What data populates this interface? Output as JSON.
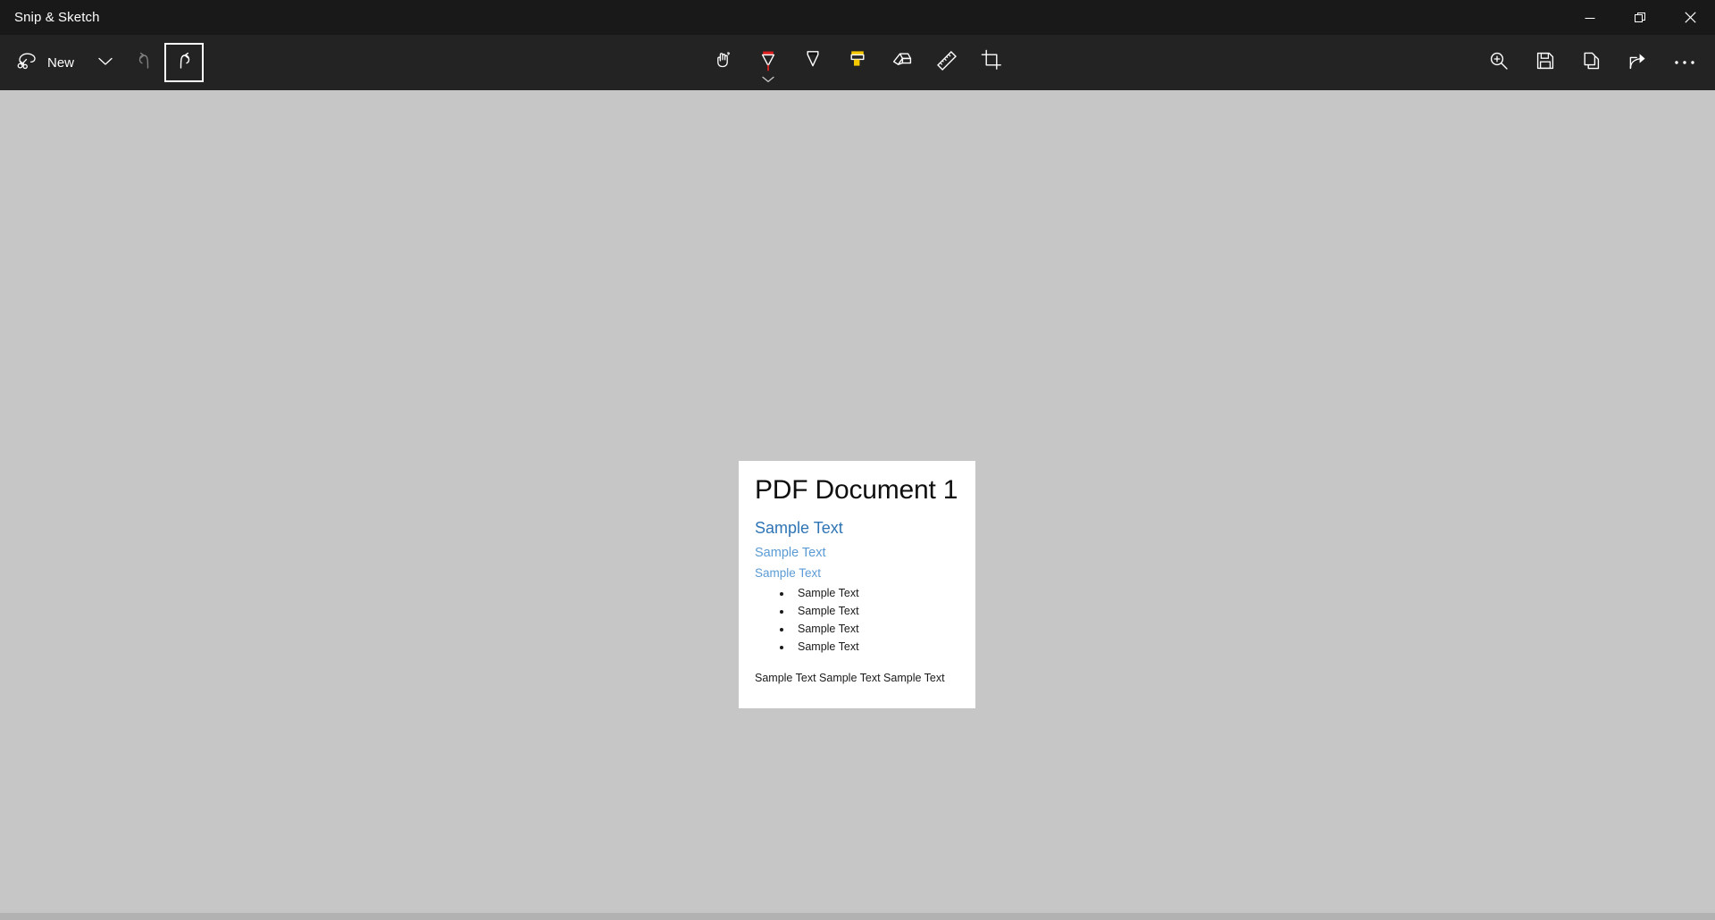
{
  "app": {
    "title": "Snip & Sketch",
    "accent_red": "#e81123",
    "canvas_color": "#c6c6c6",
    "chrome_color": "#232323",
    "titlebar_color": "#191919"
  },
  "window_controls": [
    {
      "name": "minimize",
      "icon": "minimize-icon",
      "label": "Minimize"
    },
    {
      "name": "restore",
      "icon": "restore-icon",
      "label": "Restore Down"
    },
    {
      "name": "close",
      "icon": "close-icon",
      "label": "Close"
    }
  ],
  "toolbar": {
    "new_label": "New",
    "new_icon": "snip-new-icon",
    "new_dropdown_icon": "chevron-down-icon",
    "undo_icon": "undo-icon",
    "undo_enabled": false,
    "redo_icon": "redo-icon",
    "redo_focused": true,
    "tools": [
      {
        "name": "touch-writing",
        "icon": "touch-writing-icon",
        "label": "Touch writing",
        "selected": false,
        "color": "#ffffff"
      },
      {
        "name": "ballpoint-pen",
        "icon": "ballpoint-pen-icon",
        "label": "Ballpoint pen",
        "selected": true,
        "color": "#e02020"
      },
      {
        "name": "pencil",
        "icon": "pencil-icon",
        "label": "Pencil",
        "selected": false,
        "color": "#111111"
      },
      {
        "name": "highlighter",
        "icon": "highlighter-icon",
        "label": "Highlighter",
        "selected": false,
        "color": "#f5c800"
      },
      {
        "name": "eraser",
        "icon": "eraser-icon",
        "label": "Eraser",
        "selected": false,
        "color": "#ffffff"
      },
      {
        "name": "ruler",
        "icon": "ruler-icon",
        "label": "Ruler or protractor",
        "selected": false,
        "color": "#ffffff"
      },
      {
        "name": "crop",
        "icon": "crop-icon",
        "label": "Image crop",
        "selected": false,
        "color": "#ffffff"
      }
    ],
    "right_actions": [
      {
        "name": "zoom",
        "icon": "zoom-in-icon",
        "label": "Zoom"
      },
      {
        "name": "save",
        "icon": "save-icon",
        "label": "Save as"
      },
      {
        "name": "copy",
        "icon": "copy-icon",
        "label": "Copy"
      },
      {
        "name": "share",
        "icon": "share-icon",
        "label": "Share"
      },
      {
        "name": "more",
        "icon": "ellipsis-icon",
        "label": "See more"
      }
    ]
  },
  "document": {
    "title": "PDF Document 1",
    "heading1": "Sample Text",
    "heading2": "Sample Text",
    "heading3": "Sample Text",
    "bullets": [
      "Sample Text",
      "Sample Text",
      "Sample Text",
      "Sample Text"
    ],
    "paragraph": "Sample Text Sample Text Sample Text"
  }
}
